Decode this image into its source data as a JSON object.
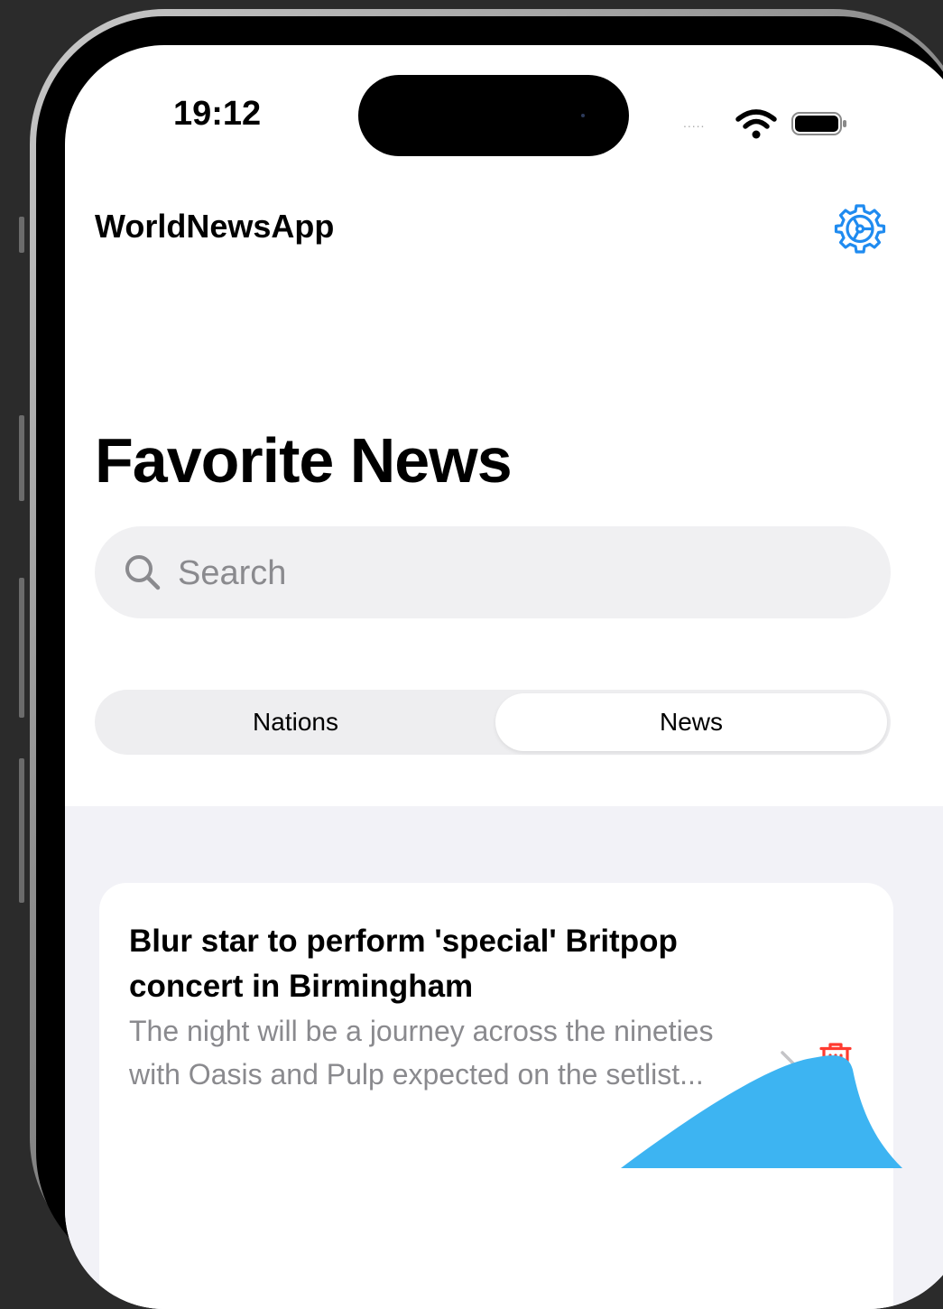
{
  "status_bar": {
    "time": "19:12",
    "signal": "....."
  },
  "nav": {
    "app_title": "WorldNewsApp",
    "settings_icon": "gear-icon"
  },
  "page": {
    "title": "Favorite News"
  },
  "search": {
    "placeholder": "Search",
    "value": ""
  },
  "segments": {
    "nations_label": "Nations",
    "news_label": "News",
    "selected": "News"
  },
  "news_items": [
    {
      "title": "Blur star to perform 'special' Britpop concert in Birmingham",
      "summary": "The night will be a journey across the nineties with Oasis and Pulp expected on the setlist..."
    }
  ],
  "colors": {
    "accent": "#1f8bf0",
    "delete": "#ff3b30",
    "secondary_text": "#8a8a8e",
    "overlay": "#3db4f2"
  }
}
